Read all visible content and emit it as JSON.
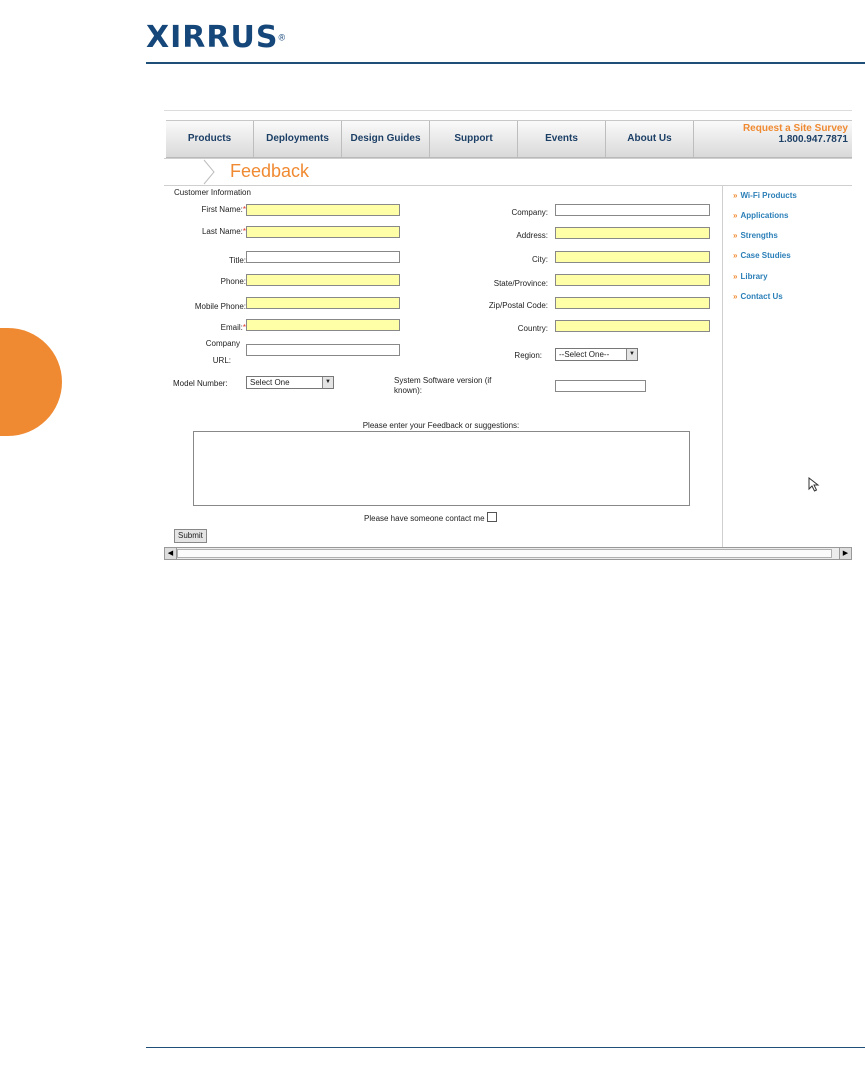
{
  "brand": {
    "logo": "XIRRUS",
    "reg": "®"
  },
  "nav": {
    "items": [
      "Products",
      "Deployments",
      "Design Guides",
      "Support",
      "Events",
      "About Us"
    ],
    "survey_label": "Request a Site Survey",
    "survey_phone": "1.800.947.7871"
  },
  "page": {
    "title": "Feedback"
  },
  "form": {
    "section": "Customer Information",
    "required_mark": "*",
    "first_name": "First Name:",
    "last_name": "Last Name:",
    "title": "Title:",
    "phone": "Phone:",
    "mobile_phone": "Mobile Phone:",
    "email": "Email:",
    "company_url_1": "Company",
    "company_url_2": "URL:",
    "company": "Company:",
    "address": "Address:",
    "city": "City:",
    "state": "State/Province:",
    "zip": "Zip/Postal Code:",
    "country": "Country:",
    "region": "Region:",
    "region_value": "--Select One--",
    "model_number": "Model Number:",
    "model_value": "Select One",
    "software_1": "System Software version (if",
    "software_2": "known):",
    "feedback_label": "Please enter your Feedback or suggestions:",
    "contact_label": "Please have someone contact me",
    "submit": "Submit"
  },
  "sidebar": {
    "items": [
      "Wi-Fi Products",
      "Applications",
      "Strengths",
      "Case Studies",
      "Library",
      "Contact Us"
    ]
  },
  "colors": {
    "brand_blue": "#16477a",
    "accent_orange": "#f08a32",
    "required_fill": "#ffffa8",
    "link_blue": "#2b7fb8"
  }
}
